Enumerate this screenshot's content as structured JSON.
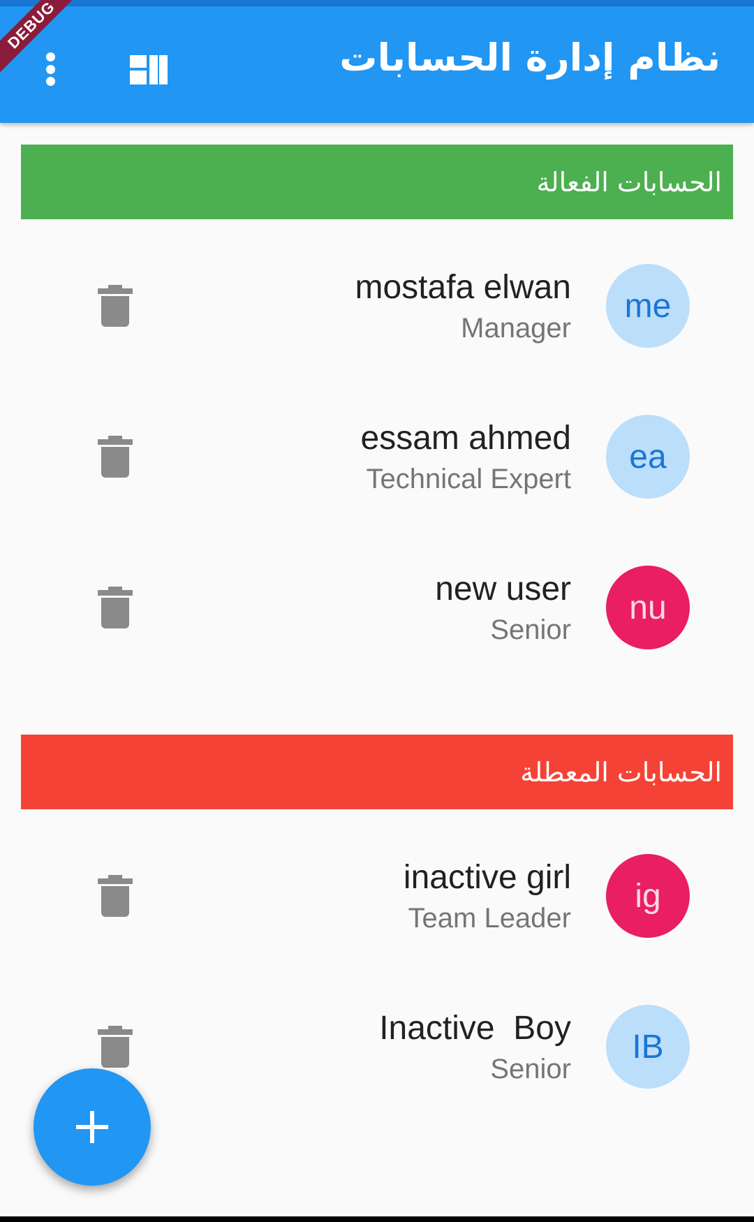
{
  "appbar": {
    "title": "نظام إدارة الحسابات",
    "debug_banner": "DEBUG",
    "menu_icon": "more-vert-icon",
    "dashboard_icon": "dashboard-icon"
  },
  "colors": {
    "primary": "#2196f3",
    "active_section": "#4caf50",
    "inactive_section": "#f44336",
    "avatar_light": "#bbdefb",
    "avatar_pink": "#e91e63"
  },
  "sections": {
    "active": {
      "title": "الحسابات الفعالة",
      "accounts": [
        {
          "name": "mostafa elwan",
          "role": "Manager",
          "initials": "me"
        },
        {
          "name": "essam ahmed",
          "role": "Technical Expert",
          "initials": "ea"
        },
        {
          "name": "new user",
          "role": "Senior",
          "initials": "nu"
        }
      ]
    },
    "inactive": {
      "title": "الحسابات المعطلة",
      "accounts": [
        {
          "name": "inactive girl",
          "role": "Team Leader",
          "initials": "ig"
        },
        {
          "name": "Inactive  Boy",
          "role": "Senior",
          "initials": "IB"
        }
      ]
    }
  },
  "fab": {
    "icon": "add-icon"
  }
}
